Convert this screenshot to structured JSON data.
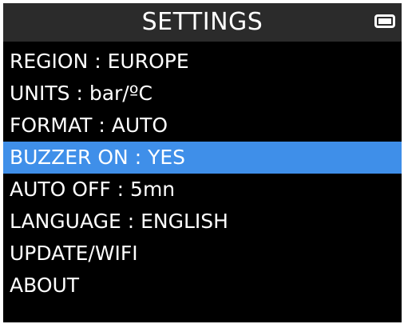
{
  "header": {
    "title": "SETTINGS",
    "battery_icon": "battery-icon"
  },
  "menu": {
    "items": [
      {
        "label": "REGION : EUROPE"
      },
      {
        "label": "UNITS : bar/ºC"
      },
      {
        "label": "FORMAT : AUTO"
      },
      {
        "label": "BUZZER ON : YES"
      },
      {
        "label": "AUTO OFF : 5mn"
      },
      {
        "label": "LANGUAGE : ENGLISH"
      },
      {
        "label": "UPDATE/WIFI"
      },
      {
        "label": "ABOUT"
      }
    ],
    "selected_index": 3
  },
  "colors": {
    "background": "#000000",
    "header_background": "#2b2b2b",
    "text": "#ffffff",
    "selection": "#3f8fe9"
  }
}
